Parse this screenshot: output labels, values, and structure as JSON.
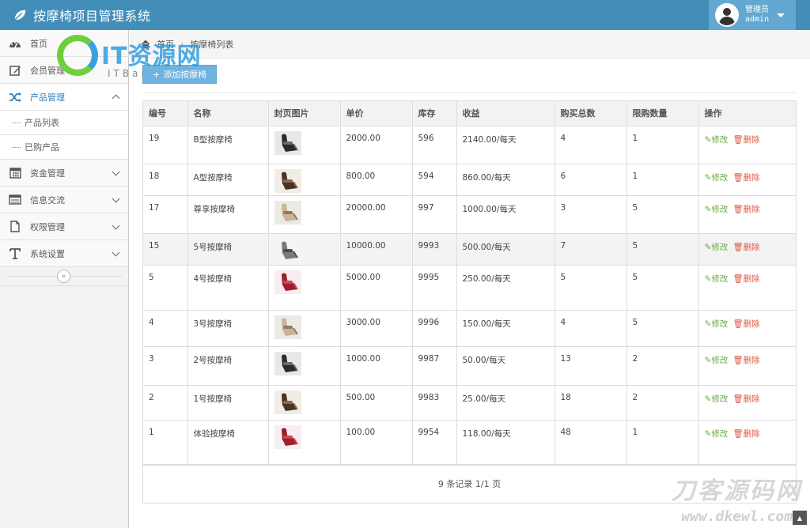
{
  "app": {
    "title": "按摩椅项目管理系统"
  },
  "user": {
    "role": "管理员",
    "name": "admin"
  },
  "sidebar": {
    "items": [
      {
        "label": "首页",
        "icon": "dashboard-icon"
      },
      {
        "label": "会员管理",
        "icon": "edit-icon"
      },
      {
        "label": "产品管理",
        "icon": "shuffle-icon"
      },
      {
        "label": "资金管理",
        "icon": "calendar-icon"
      },
      {
        "label": "信息交流",
        "icon": "list-icon"
      },
      {
        "label": "权限管理",
        "icon": "file-icon"
      },
      {
        "label": "系统设置",
        "icon": "text-icon"
      }
    ],
    "sub_items": [
      {
        "label": "产品列表"
      },
      {
        "label": "已购产品"
      }
    ]
  },
  "breadcrumb": {
    "home": "首页",
    "current": "按摩椅列表"
  },
  "toolbar": {
    "add_label": "添加按摩椅"
  },
  "table": {
    "headers": [
      "编号",
      "名称",
      "封页图片",
      "单价",
      "库存",
      "收益",
      "购买总数",
      "限购数量",
      "操作"
    ],
    "rows": [
      {
        "id": "19",
        "name": "B型按摩椅",
        "price": "2000.00",
        "stock": "596",
        "income": "2140.00/每天",
        "bought": "4",
        "limit": "1",
        "img": "dark"
      },
      {
        "id": "18",
        "name": "A型按摩椅",
        "price": "800.00",
        "stock": "594",
        "income": "860.00/每天",
        "bought": "6",
        "limit": "1",
        "img": "brown"
      },
      {
        "id": "17",
        "name": "尊享按摩椅",
        "price": "20000.00",
        "stock": "997",
        "income": "1000.00/每天",
        "bought": "3",
        "limit": "5",
        "img": "beige"
      },
      {
        "id": "15",
        "name": "5号按摩椅",
        "price": "10000.00",
        "stock": "9993",
        "income": "500.00/每天",
        "bought": "7",
        "limit": "5",
        "img": "grey"
      },
      {
        "id": "5",
        "name": "4号按摩椅",
        "price": "5000.00",
        "stock": "9995",
        "income": "250.00/每天",
        "bought": "5",
        "limit": "5",
        "img": "red"
      },
      {
        "id": "4",
        "name": "3号按摩椅",
        "price": "3000.00",
        "stock": "9996",
        "income": "150.00/每天",
        "bought": "4",
        "limit": "5",
        "img": "beige"
      },
      {
        "id": "3",
        "name": "2号按摩椅",
        "price": "1000.00",
        "stock": "9987",
        "income": "50.00/每天",
        "bought": "13",
        "limit": "2",
        "img": "dark"
      },
      {
        "id": "2",
        "name": "1号按摩椅",
        "price": "500.00",
        "stock": "9983",
        "income": "25.00/每天",
        "bought": "18",
        "limit": "2",
        "img": "brown"
      },
      {
        "id": "1",
        "name": "体验按摩椅",
        "price": "100.00",
        "stock": "9954",
        "income": "118.00/每天",
        "bought": "48",
        "limit": "1",
        "img": "red"
      }
    ],
    "edit_label": "修改",
    "delete_label": "删除",
    "footer": "9 条记录 1/1 页"
  },
  "watermarks": {
    "top": "IT资源网",
    "top_sub": "ITBai",
    "bottom": "刀客源码网",
    "bottom_url": "www.dkewl.com"
  },
  "colors": {
    "navbar": "#438eb9",
    "user_box": "#62a8d1",
    "accent": "#2b7dbc",
    "edit": "#69aa46",
    "delete": "#dd5a43",
    "add_button": "#6fb3e0"
  }
}
